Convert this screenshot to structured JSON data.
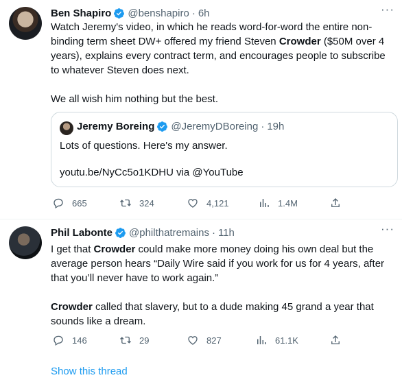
{
  "tweet1": {
    "name": "Ben Shapiro",
    "handle": "@benshapiro",
    "dot": "·",
    "time": "6h",
    "text_parts": [
      "Watch Jeremy's video, in which he reads word-for-word the entire non-binding term sheet DW+ offered my friend Steven ",
      "Crowder",
      " ($50M over 4 years), explains every contract term, and encourages people to subscribe to whatever Steven does next."
    ],
    "text2": "We all wish him nothing but the best.",
    "quote": {
      "name": "Jeremy Boreing",
      "handle": "@JeremyDBoreing",
      "dot": "·",
      "time": "19h",
      "line1": "Lots of questions. Here's my answer.",
      "line2": "youtu.be/NyCc5o1KDHU via @YouTube"
    },
    "actions": {
      "replies": "665",
      "retweets": "324",
      "likes": "4,121",
      "views": "1.4M"
    }
  },
  "tweet2": {
    "name": "Phil Labonte",
    "handle": "@philthatremains",
    "dot": "·",
    "time": "11h",
    "text_parts": [
      "I get that ",
      "Crowder",
      " could make more money doing his own deal but the average person hears “Daily Wire said if you work for us for 4 years, after that you’ll never have to work again.”"
    ],
    "text2_parts": [
      "Crowder",
      " called that slavery, but to a dude making 45 grand a year that sounds like a dream."
    ],
    "actions": {
      "replies": "146",
      "retweets": "29",
      "likes": "827",
      "views": "61.1K"
    }
  },
  "show_thread": "Show this thread",
  "icons": {
    "verified": "verified-badge-icon",
    "reply": "reply-icon",
    "retweet": "retweet-icon",
    "like": "heart-icon",
    "views": "views-chart-icon",
    "share": "share-icon",
    "more": "more-dots-icon"
  },
  "colors": {
    "accent": "#1d9bf0",
    "text": "#0f1419",
    "secondary": "#536471",
    "border": "#cfd9de"
  }
}
